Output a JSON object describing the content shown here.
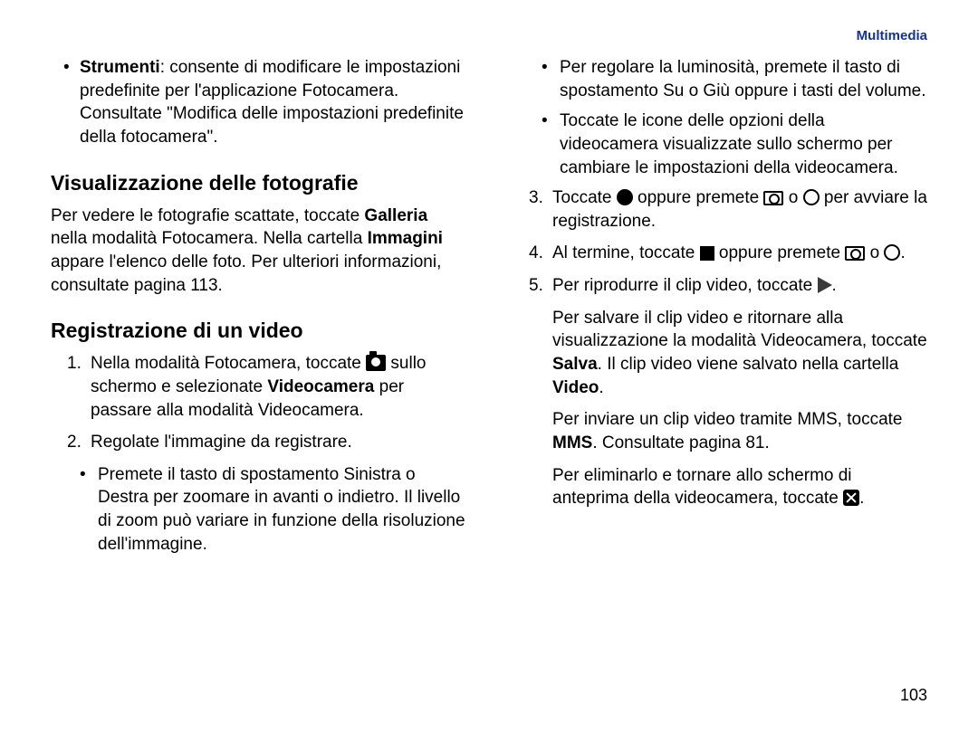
{
  "header": {
    "section": "Multimedia"
  },
  "page_number": "103",
  "col_left": {
    "bullet1_strong": "Strumenti",
    "bullet1_rest": ": consente di modificare le impostazioni predefinite per l'applicazione Fotocamera. Consultate \"Modifica delle impostazioni predefinite della fotocamera\".",
    "h1": "Visualizzazione delle fotografie",
    "p1a": "Per vedere le fotografie scattate, toccate ",
    "p1b": "Galleria",
    "p1c": " nella modalità Fotocamera. Nella cartella ",
    "p1d": "Immagini",
    "p1e": " appare l'elenco delle foto. Per ulteriori informazioni, consultate pagina 113.",
    "h2": "Registrazione di un video",
    "step1a": "Nella modalità Fotocamera, toccate ",
    "step1b": " sullo schermo e selezionate ",
    "step1c": "Videocamera",
    "step1d": " per passare alla modalità Videocamera.",
    "step2": "Regolate l'immagine da registrare.",
    "sub1": "Premete il tasto di spostamento Sinistra o Destra per zoomare in avanti o indietro. Il livello di zoom può variare in funzione della risoluzione dell'immagine."
  },
  "col_right": {
    "sub2": "Per regolare la luminosità, premete il tasto di spostamento Su o Giù oppure i tasti del volume.",
    "sub3": "Toccate le icone delle opzioni della videocamera visualizzate sullo schermo per cambiare le impostazioni della videocamera.",
    "step3a": "Toccate ",
    "step3b": " oppure premete ",
    "step3c": " o ",
    "step3d": " per avviare la registrazione.",
    "step4a": "Al termine, toccate ",
    "step4b": " oppure premete ",
    "step4c": " o ",
    "step4d": ".",
    "step5a": "Per riprodurre il clip video, toccate ",
    "step5b": ".",
    "p2a": "Per salvare il clip video e ritornare alla visualizzazione la modalità Videocamera, toccate ",
    "p2b": "Salva",
    "p2c": ". Il clip video viene salvato nella cartella ",
    "p2d": "Video",
    "p2e": ".",
    "p3a": "Per inviare un clip video tramite MMS, toccate ",
    "p3b": "MMS",
    "p3c": ". Consultate pagina 81.",
    "p4a": "Per eliminarlo e tornare allo schermo di anteprima della videocamera, toccate ",
    "p4b": "."
  }
}
